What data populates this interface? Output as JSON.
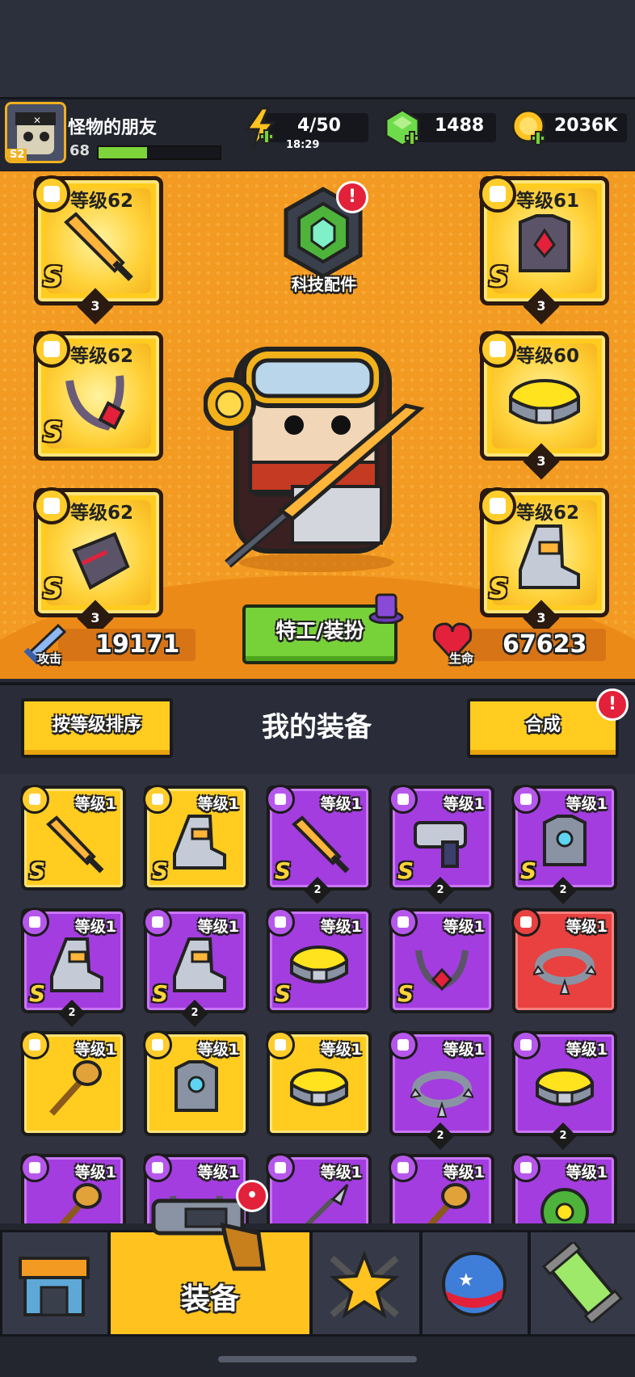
{
  "player": {
    "name": "怪物的朋友",
    "level": "68",
    "season": "S2",
    "xp_fraction": 0.4
  },
  "resources": {
    "energy": {
      "value": "4/50",
      "timer": "18:29"
    },
    "gems": {
      "value": "1488"
    },
    "coins": {
      "value": "2036K"
    }
  },
  "hero": {
    "tech_label": "科技配件",
    "tech_alert": "!",
    "agent_button": "特工/装扮",
    "attack_label": "攻击",
    "attack_value": "19171",
    "hp_label": "生命",
    "hp_value": "67623",
    "slots": [
      {
        "type": "weapon",
        "level": "等级62",
        "rank": "S",
        "stars": "3"
      },
      {
        "type": "armor",
        "level": "等级61",
        "rank": "S",
        "stars": "3"
      },
      {
        "type": "necklace",
        "level": "等级62",
        "rank": "S",
        "stars": ""
      },
      {
        "type": "belt",
        "level": "等级60",
        "rank": "",
        "stars": "3"
      },
      {
        "type": "gloves",
        "level": "等级62",
        "rank": "S",
        "stars": "3"
      },
      {
        "type": "boots",
        "level": "等级62",
        "rank": "S",
        "stars": "3"
      }
    ]
  },
  "equipment": {
    "sort_button": "按等级排序",
    "title": "我的装备",
    "merge_button": "合成",
    "merge_alert": "!",
    "items": [
      {
        "rarity": "gold",
        "icon": "sword",
        "level": "等级1",
        "rank": "S",
        "stars": ""
      },
      {
        "rarity": "gold",
        "icon": "boots",
        "level": "等级1",
        "rank": "S",
        "stars": ""
      },
      {
        "rarity": "purple",
        "icon": "sword",
        "level": "等级1",
        "rank": "S",
        "stars": "2"
      },
      {
        "rarity": "purple",
        "icon": "gun",
        "level": "等级1",
        "rank": "S",
        "stars": "2"
      },
      {
        "rarity": "purple",
        "icon": "armor",
        "level": "等级1",
        "rank": "S",
        "stars": "2"
      },
      {
        "rarity": "purple",
        "icon": "boots",
        "level": "等级1",
        "rank": "S",
        "stars": "2"
      },
      {
        "rarity": "purple",
        "icon": "boots",
        "level": "等级1",
        "rank": "S",
        "stars": "2"
      },
      {
        "rarity": "purple",
        "icon": "belt",
        "level": "等级1",
        "rank": "S",
        "stars": ""
      },
      {
        "rarity": "purple",
        "icon": "necklace",
        "level": "等级1",
        "rank": "S",
        "stars": ""
      },
      {
        "rarity": "red",
        "icon": "spiked-collar",
        "level": "等级1",
        "rank": "",
        "stars": ""
      },
      {
        "rarity": "gold",
        "icon": "hammer",
        "level": "等级1",
        "rank": "",
        "stars": ""
      },
      {
        "rarity": "gold",
        "icon": "armor",
        "level": "等级1",
        "rank": "",
        "stars": ""
      },
      {
        "rarity": "gold",
        "icon": "belt",
        "level": "等级1",
        "rank": "",
        "stars": ""
      },
      {
        "rarity": "purple",
        "icon": "spiked-collar",
        "level": "等级1",
        "rank": "",
        "stars": "2"
      },
      {
        "rarity": "purple",
        "icon": "belt",
        "level": "等级1",
        "rank": "",
        "stars": "2"
      },
      {
        "rarity": "purple",
        "icon": "hammer",
        "level": "等级1",
        "rank": "",
        "stars": ""
      },
      {
        "rarity": "purple",
        "icon": "necklace",
        "level": "等级1",
        "rank": "",
        "stars": ""
      },
      {
        "rarity": "purple",
        "icon": "spear",
        "level": "等级1",
        "rank": "",
        "stars": ""
      },
      {
        "rarity": "purple",
        "icon": "hammer",
        "level": "等级1",
        "rank": "",
        "stars": ""
      },
      {
        "rarity": "purple",
        "icon": "plant-armor",
        "level": "等级1",
        "rank": "",
        "stars": ""
      }
    ]
  },
  "nav": {
    "tabs": [
      {
        "icon": "shop-icon"
      },
      {
        "icon": "gun-icon",
        "label": "装备"
      },
      {
        "icon": "star-swords-icon"
      },
      {
        "icon": "planet-icon"
      },
      {
        "icon": "dna-icon"
      }
    ]
  },
  "colors": {
    "hero_bg": "#f29a21",
    "gold": "#ffcc1f",
    "purple": "#a33ddf",
    "red": "#e8413f",
    "green": "#77d23a"
  }
}
